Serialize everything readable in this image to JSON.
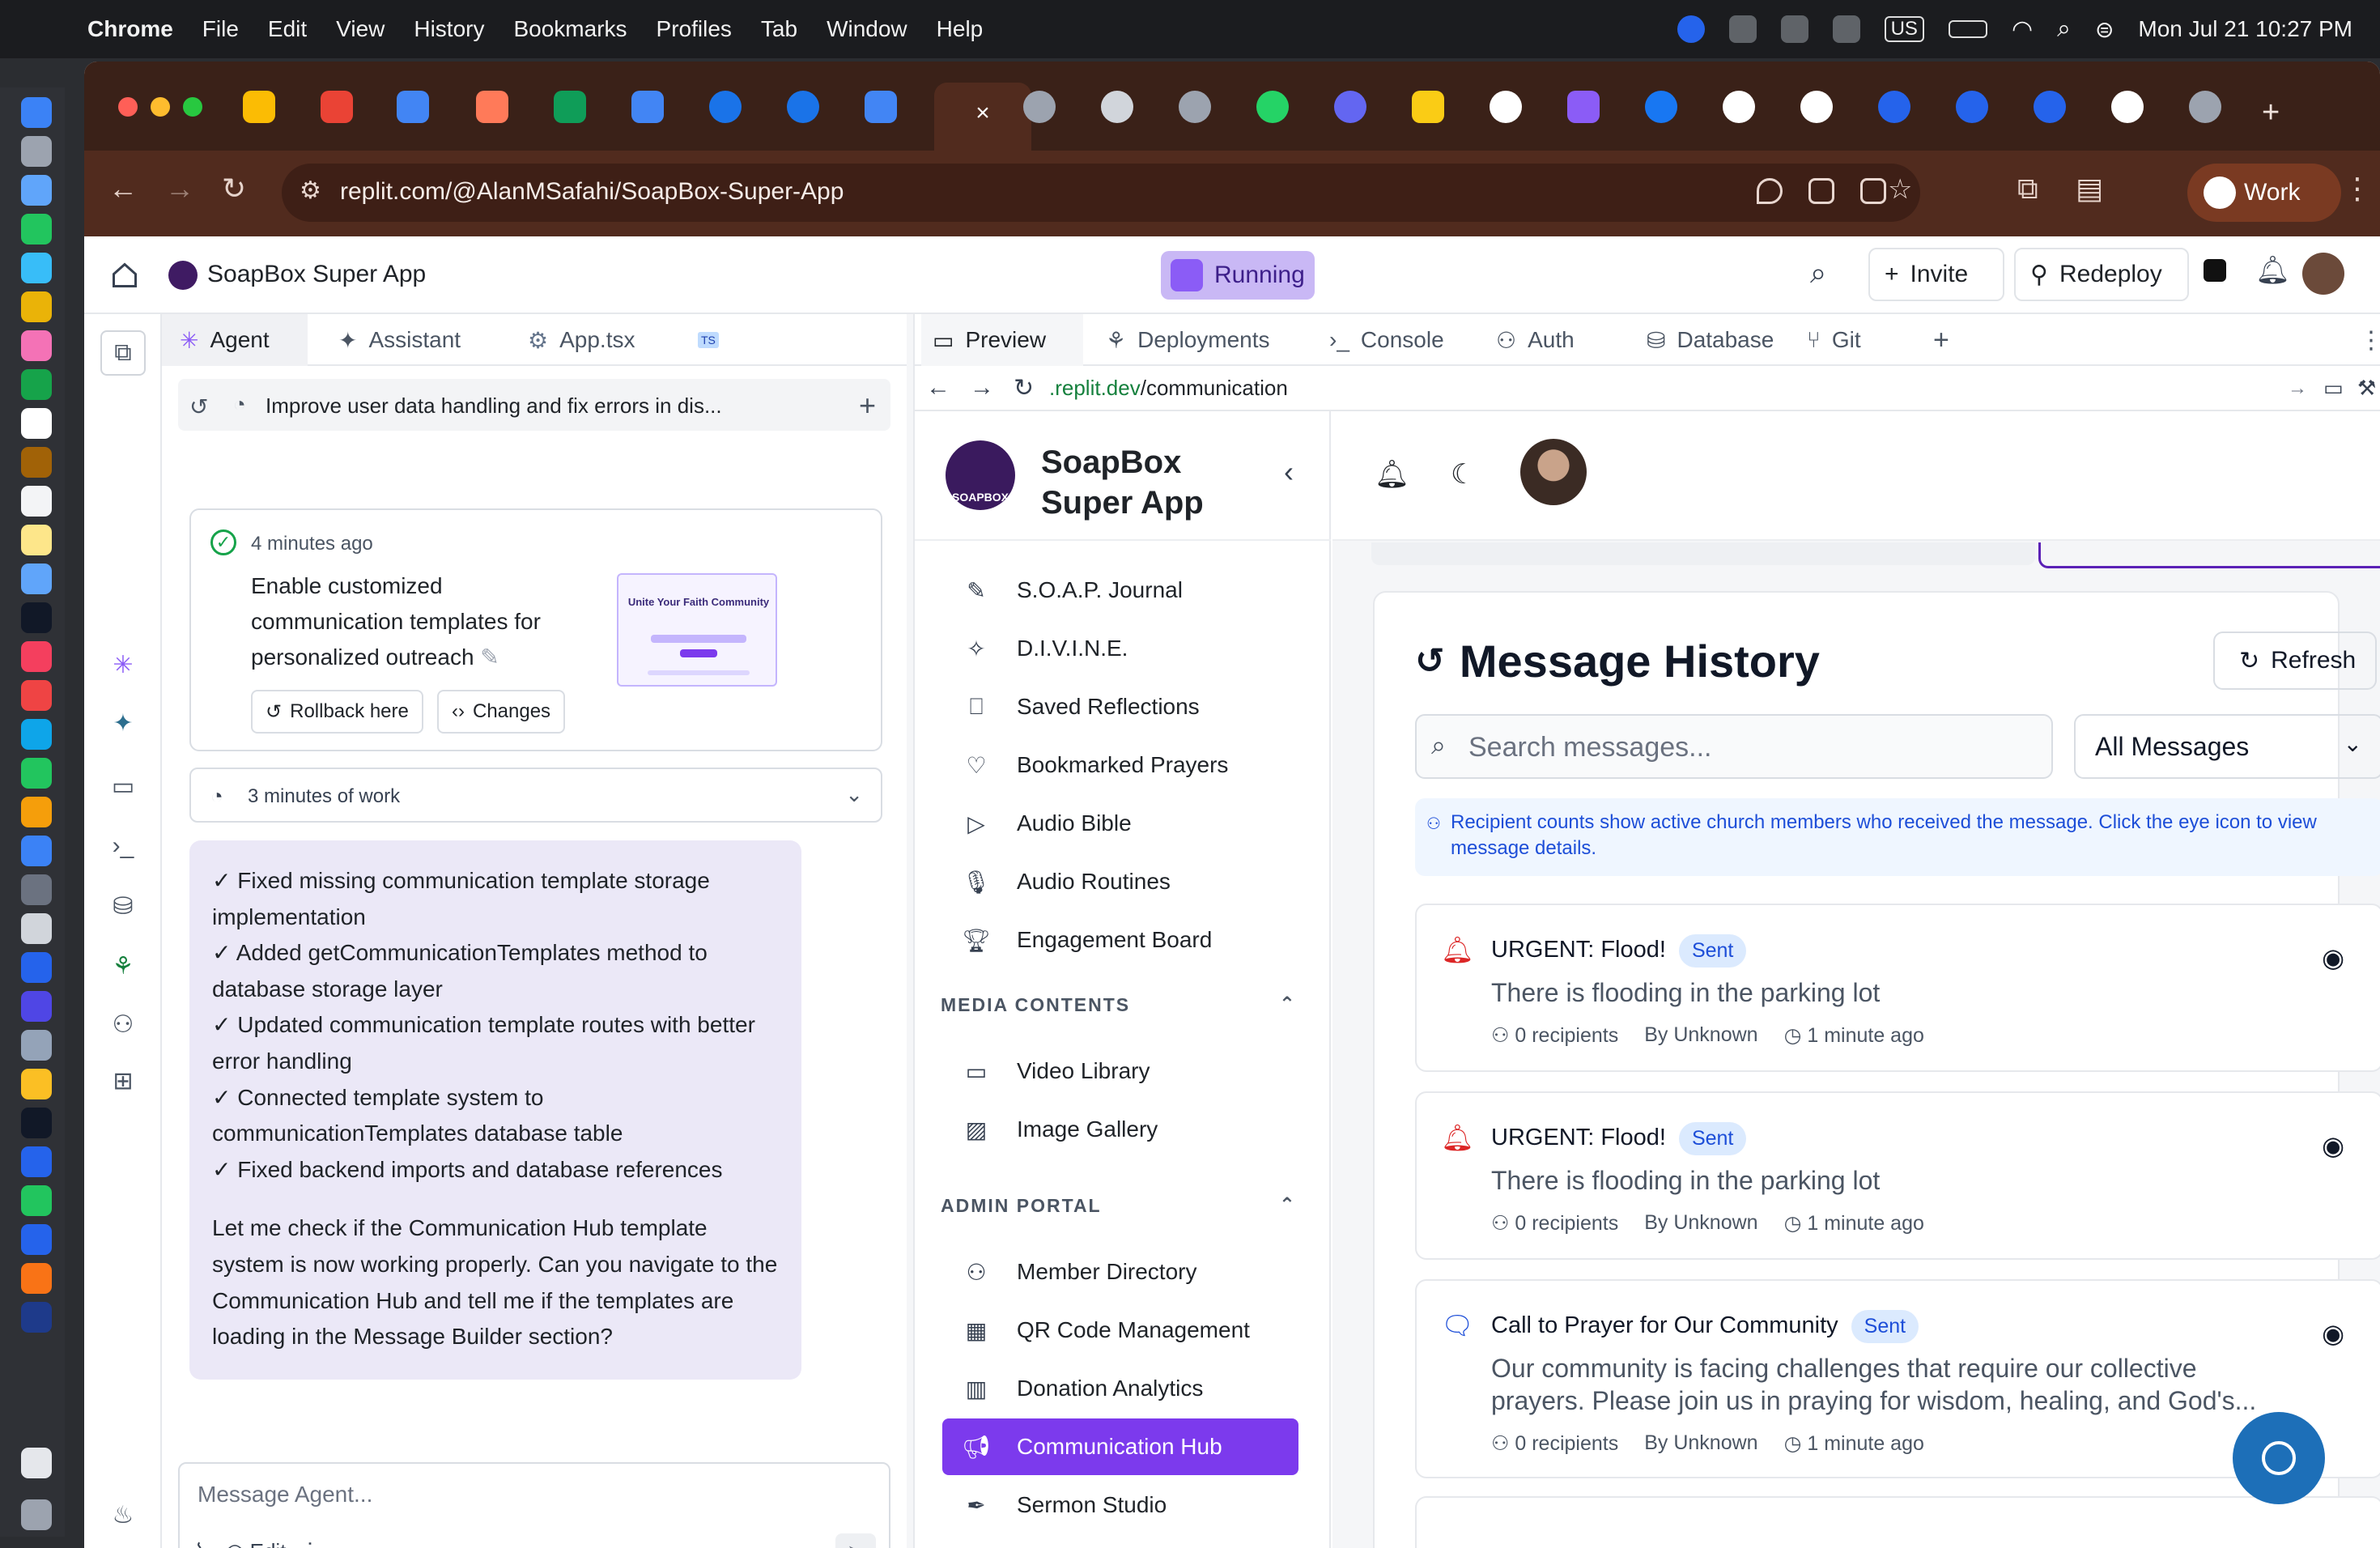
{
  "menubar": {
    "app": "Chrome",
    "menus": [
      "File",
      "Edit",
      "View",
      "History",
      "Bookmarks",
      "Profiles",
      "Tab",
      "Window",
      "Help"
    ],
    "keyboard": "US",
    "datetime": "Mon Jul 21  10:27 PM"
  },
  "browser": {
    "url": "replit.com/@AlanMSafahi/SoapBox-Super-App",
    "profile": "Work",
    "active_tab_symbol": "×"
  },
  "replit": {
    "project_title": "SoapBox Super App",
    "run_status": "Running",
    "invite_label": "Invite",
    "redeploy_label": "Redeploy",
    "left_tabs": [
      "Agent",
      "Assistant",
      "App.tsx"
    ],
    "thread_title": "Improve user data handling and fix errors in dis...",
    "checkpoint": {
      "time": "4 minutes ago",
      "message": "Enable customized communication templates for personalized outreach",
      "thumb_title": "Unite Your Faith Community",
      "rollback_label": "Rollback here",
      "changes_label": "Changes"
    },
    "work_summary": "3 minutes of work",
    "agent_message": {
      "items": [
        "✓ Fixed missing communication template storage implementation",
        "✓ Added getCommunicationTemplates method to database storage layer",
        "✓ Updated communication template routes with better error handling",
        "✓ Connected template system to communicationTemplates database table",
        "✓ Fixed backend imports and database references"
      ],
      "closing": "Let me check if the Communication Hub template system is now working properly. Can you navigate to the Communication Hub and tell me if the templates are loading in the Message Builder section?"
    },
    "input_placeholder": "Message Agent...",
    "edit_label": "Edit",
    "workspace_tabs": [
      "Preview",
      "Deployments",
      "Console",
      "Auth",
      "Database",
      "Git"
    ],
    "preview_url_host": ".replit.dev",
    "preview_url_path": "/communication"
  },
  "soapbox": {
    "logo_text": "SOAPBOX",
    "brand": "SoapBox Super App",
    "nav_main": [
      "S.O.A.P. Journal",
      "D.I.V.I.N.E.",
      "Saved Reflections",
      "Bookmarked Prayers",
      "Audio Bible",
      "Audio Routines",
      "Engagement Board"
    ],
    "section_media": "MEDIA CONTENTS",
    "nav_media": [
      "Video Library",
      "Image Gallery"
    ],
    "section_admin": "ADMIN PORTAL",
    "nav_admin": [
      "Member Directory",
      "QR Code Management",
      "Donation Analytics",
      "Communication Hub",
      "Sermon Studio"
    ],
    "active_nav": "Communication Hub",
    "history": {
      "title": "Message History",
      "refresh_label": "Refresh",
      "search_placeholder": "Search messages...",
      "filter_value": "All Messages",
      "info": "Recipient counts show active church members who received the message. Click the eye icon to view message details.",
      "messages": [
        {
          "title": "URGENT: Flood!",
          "status": "Sent",
          "body": "There is flooding in the parking lot",
          "recipients": "0 recipients",
          "author": "By Unknown",
          "time": "1 minute ago",
          "icon": "bell-icon"
        },
        {
          "title": "URGENT: Flood!",
          "status": "Sent",
          "body": "There is flooding in the parking lot",
          "recipients": "0 recipients",
          "author": "By Unknown",
          "time": "1 minute ago",
          "icon": "bell-icon"
        },
        {
          "title": "Call to Prayer for Our Community",
          "status": "Sent",
          "body": "Our community is facing challenges that require our collective prayers. Please join us in praying for wisdom, healing, and God's...",
          "recipients": "0 recipients",
          "author": "By Unknown",
          "time": "1 minute ago",
          "icon": "message-icon"
        }
      ]
    }
  },
  "colors": {
    "accent": "#7c3aed",
    "urgent": "#dc2626",
    "info": "#1d4ed8",
    "chrome_frame": "#512b1e"
  }
}
